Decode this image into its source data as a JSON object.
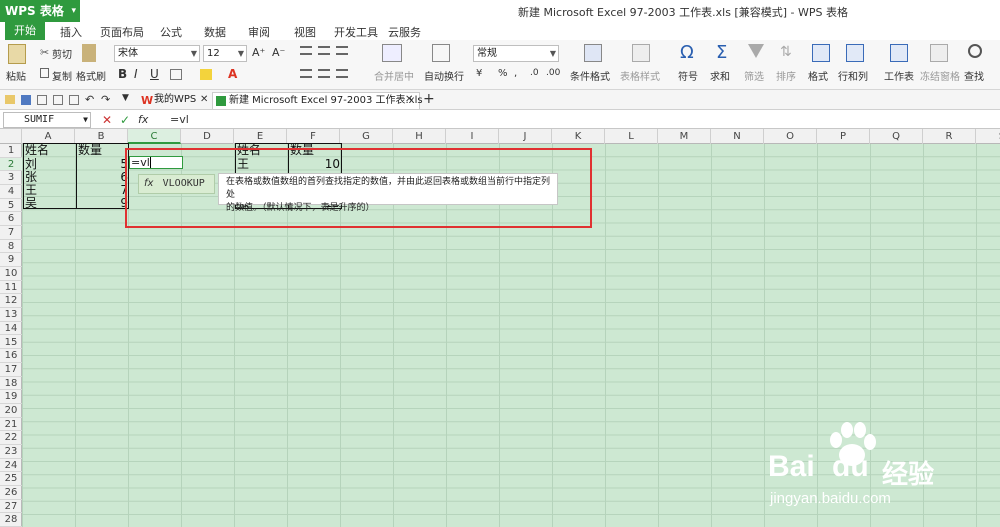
{
  "app": {
    "logo": "WPS 表格",
    "logo_arrow": "▾",
    "title": "新建 Microsoft Excel 97-2003 工作表.xls [兼容模式] - WPS 表格"
  },
  "menu": [
    "开始",
    "插入",
    "页面布局",
    "公式",
    "数据",
    "审阅",
    "视图",
    "开发工具",
    "云服务"
  ],
  "ribbon": {
    "paste": "粘贴",
    "cut": "剪切",
    "copy": "复制",
    "format_painter": "格式刷",
    "font": "宋体",
    "size": "12",
    "grow": "A⁺",
    "shrink": "A⁻",
    "bold": "B",
    "italic": "I",
    "underline": "U",
    "merge": "合并居中",
    "wrap": "自动换行",
    "number_format": "常规",
    "cond_format": "条件格式",
    "table_style": "表格样式",
    "symbol": "符号",
    "sum": "求和",
    "filter": "筛选",
    "sort": "排序",
    "format": "格式",
    "rowcol": "行和列",
    "sheet": "工作表",
    "freeze": "冻结窗格",
    "find": "查找"
  },
  "doc_tabs": {
    "mywps": "我的WPS",
    "file": "新建 Microsoft Excel 97-2003 工作表.xls",
    "add": "+"
  },
  "formula_bar": {
    "name": "SUMIF",
    "cancel": "✕",
    "accept": "✓",
    "fx": "fx",
    "content": "=vl"
  },
  "columns": [
    "A",
    "B",
    "C",
    "D",
    "E",
    "F",
    "G",
    "H",
    "I",
    "J",
    "K",
    "L",
    "M",
    "N",
    "O",
    "P",
    "Q",
    "R",
    "S"
  ],
  "rows": [
    "1",
    "2",
    "3",
    "4",
    "5",
    "6",
    "7",
    "8",
    "9",
    "10",
    "11",
    "12",
    "13",
    "14",
    "15",
    "16",
    "17",
    "18",
    "19",
    "20",
    "21",
    "22",
    "23",
    "24",
    "25",
    "26",
    "27",
    "28"
  ],
  "table1": {
    "header": [
      "姓名",
      "数量"
    ],
    "names": [
      "刘",
      "张",
      "王",
      "吴"
    ],
    "values": [
      "5",
      "6",
      "7",
      "9"
    ]
  },
  "table2": {
    "header": [
      "姓名",
      "数量"
    ],
    "names": [
      "王",
      "",
      "",
      "张"
    ],
    "values": [
      "10",
      "",
      "",
      "13"
    ]
  },
  "editing": {
    "cell_text": "=vl"
  },
  "autocomplete": {
    "fx": "fx",
    "suggestion": "VLOOKUP"
  },
  "tooltip": {
    "line1": "在表格或数值数组的首列查找指定的数值，并由此返回表格或数组当前行中指定列处",
    "line2": "的数值。（默认情况下，表是升序的）"
  },
  "watermark": {
    "brand": "Bai",
    "brand2": "du",
    "jingyan": "经验",
    "url": "jingyan.baidu.com"
  },
  "colors": {
    "accent": "#2f9a3e",
    "grid_bg": "#cde8d2",
    "highlight": "#e03131"
  }
}
